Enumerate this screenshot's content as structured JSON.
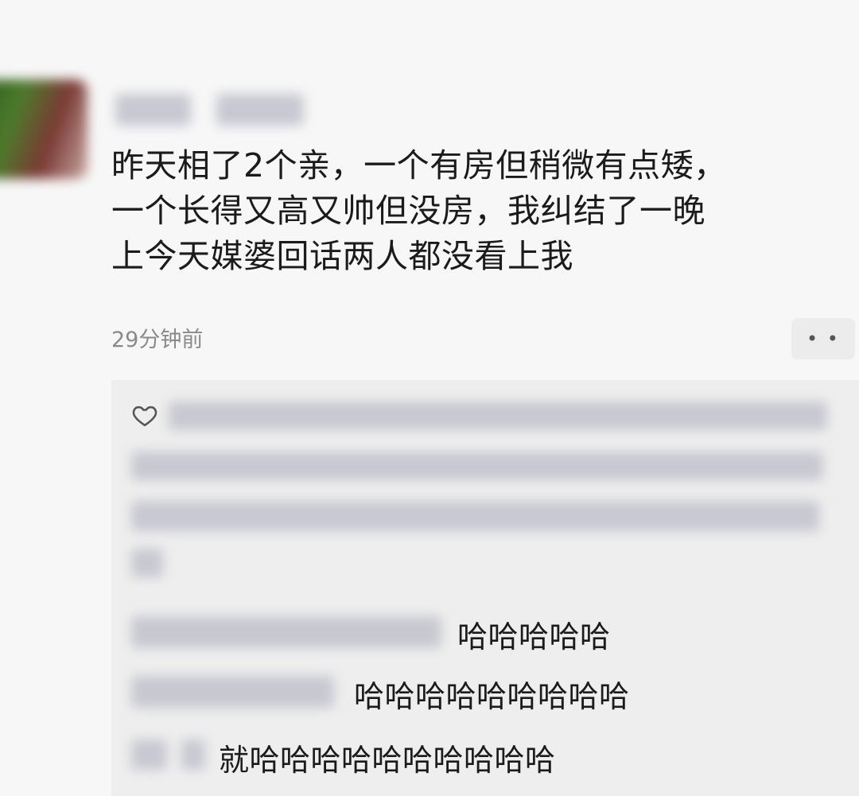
{
  "post": {
    "lines": [
      "昨天相了2个亲，一个有房但稍微有点矮，",
      "一个长得又高又帅但没房，我纠结了一晚",
      "上今天媒婆回话两人都没看上我"
    ],
    "time": "29分钟前",
    "more_label": "• •"
  },
  "comments": {
    "replies": [
      "哈哈哈哈哈",
      "哈哈哈哈哈哈哈哈哈",
      "就哈哈哈哈哈哈哈哈哈哈"
    ]
  },
  "icons": {
    "like": "heart-outline-icon",
    "more": "more-dots-icon"
  }
}
